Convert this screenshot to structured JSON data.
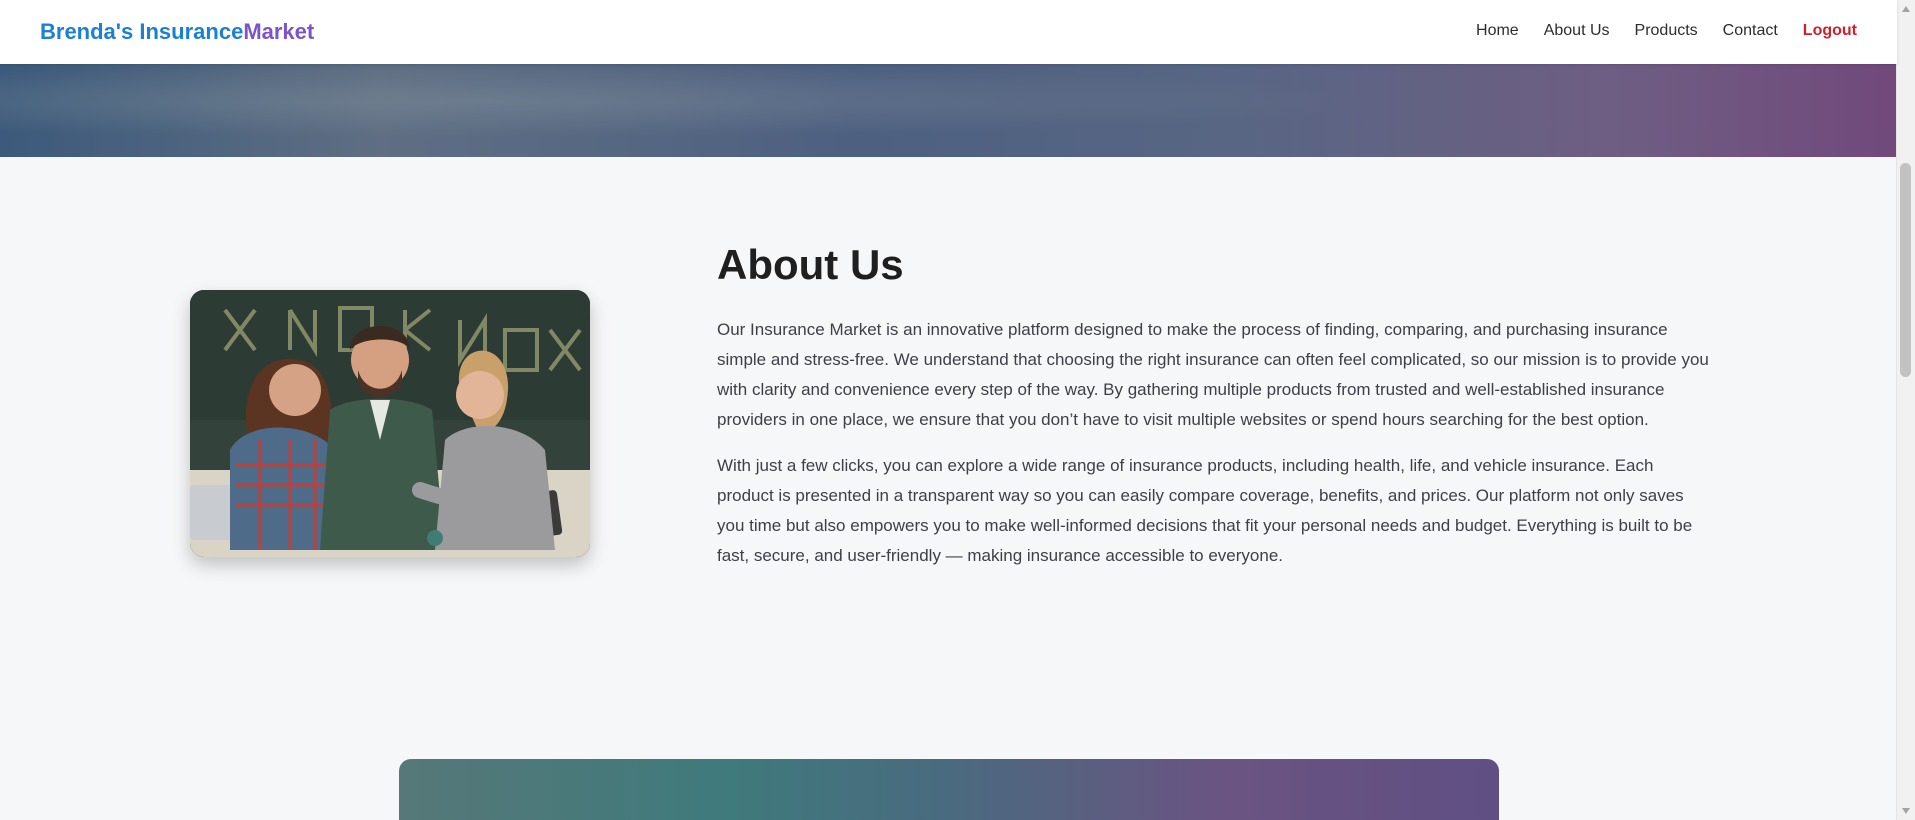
{
  "brand": {
    "part1": "Brenda's Insurance",
    "part2": "Market"
  },
  "nav": {
    "home": "Home",
    "about": "About Us",
    "products": "Products",
    "contact": "Contact",
    "logout": "Logout"
  },
  "about": {
    "title": "About Us",
    "paragraph1": "Our Insurance Market is an innovative platform designed to make the process of finding, comparing, and purchasing insurance simple and stress-free. We understand that choosing the right insurance can often feel complicated, so our mission is to provide you with clarity and convenience every step of the way. By gathering multiple products from trusted and well-established insurance providers in one place, we ensure that you don’t have to visit multiple websites or spend hours searching for the best option.",
    "paragraph2": "With just a few clicks, you can explore a wide range of insurance products, including health, life, and vehicle insurance. Each product is presented in a transparent way so you can easily compare coverage, benefits, and prices. Our platform not only saves you time but also empowers you to make well-informed decisions that fit your personal needs and budget. Everything is built to be fast, secure, and user-friendly — making insurance accessible to everyone."
  },
  "colors": {
    "brand_primary": "#1c7fd6",
    "brand_secondary": "#7a54c8",
    "logout": "#d0202b",
    "page_background": "#f6f7f8"
  },
  "icons": {
    "scroll_up": "triangle-up-icon",
    "scroll_down": "triangle-down-icon"
  }
}
